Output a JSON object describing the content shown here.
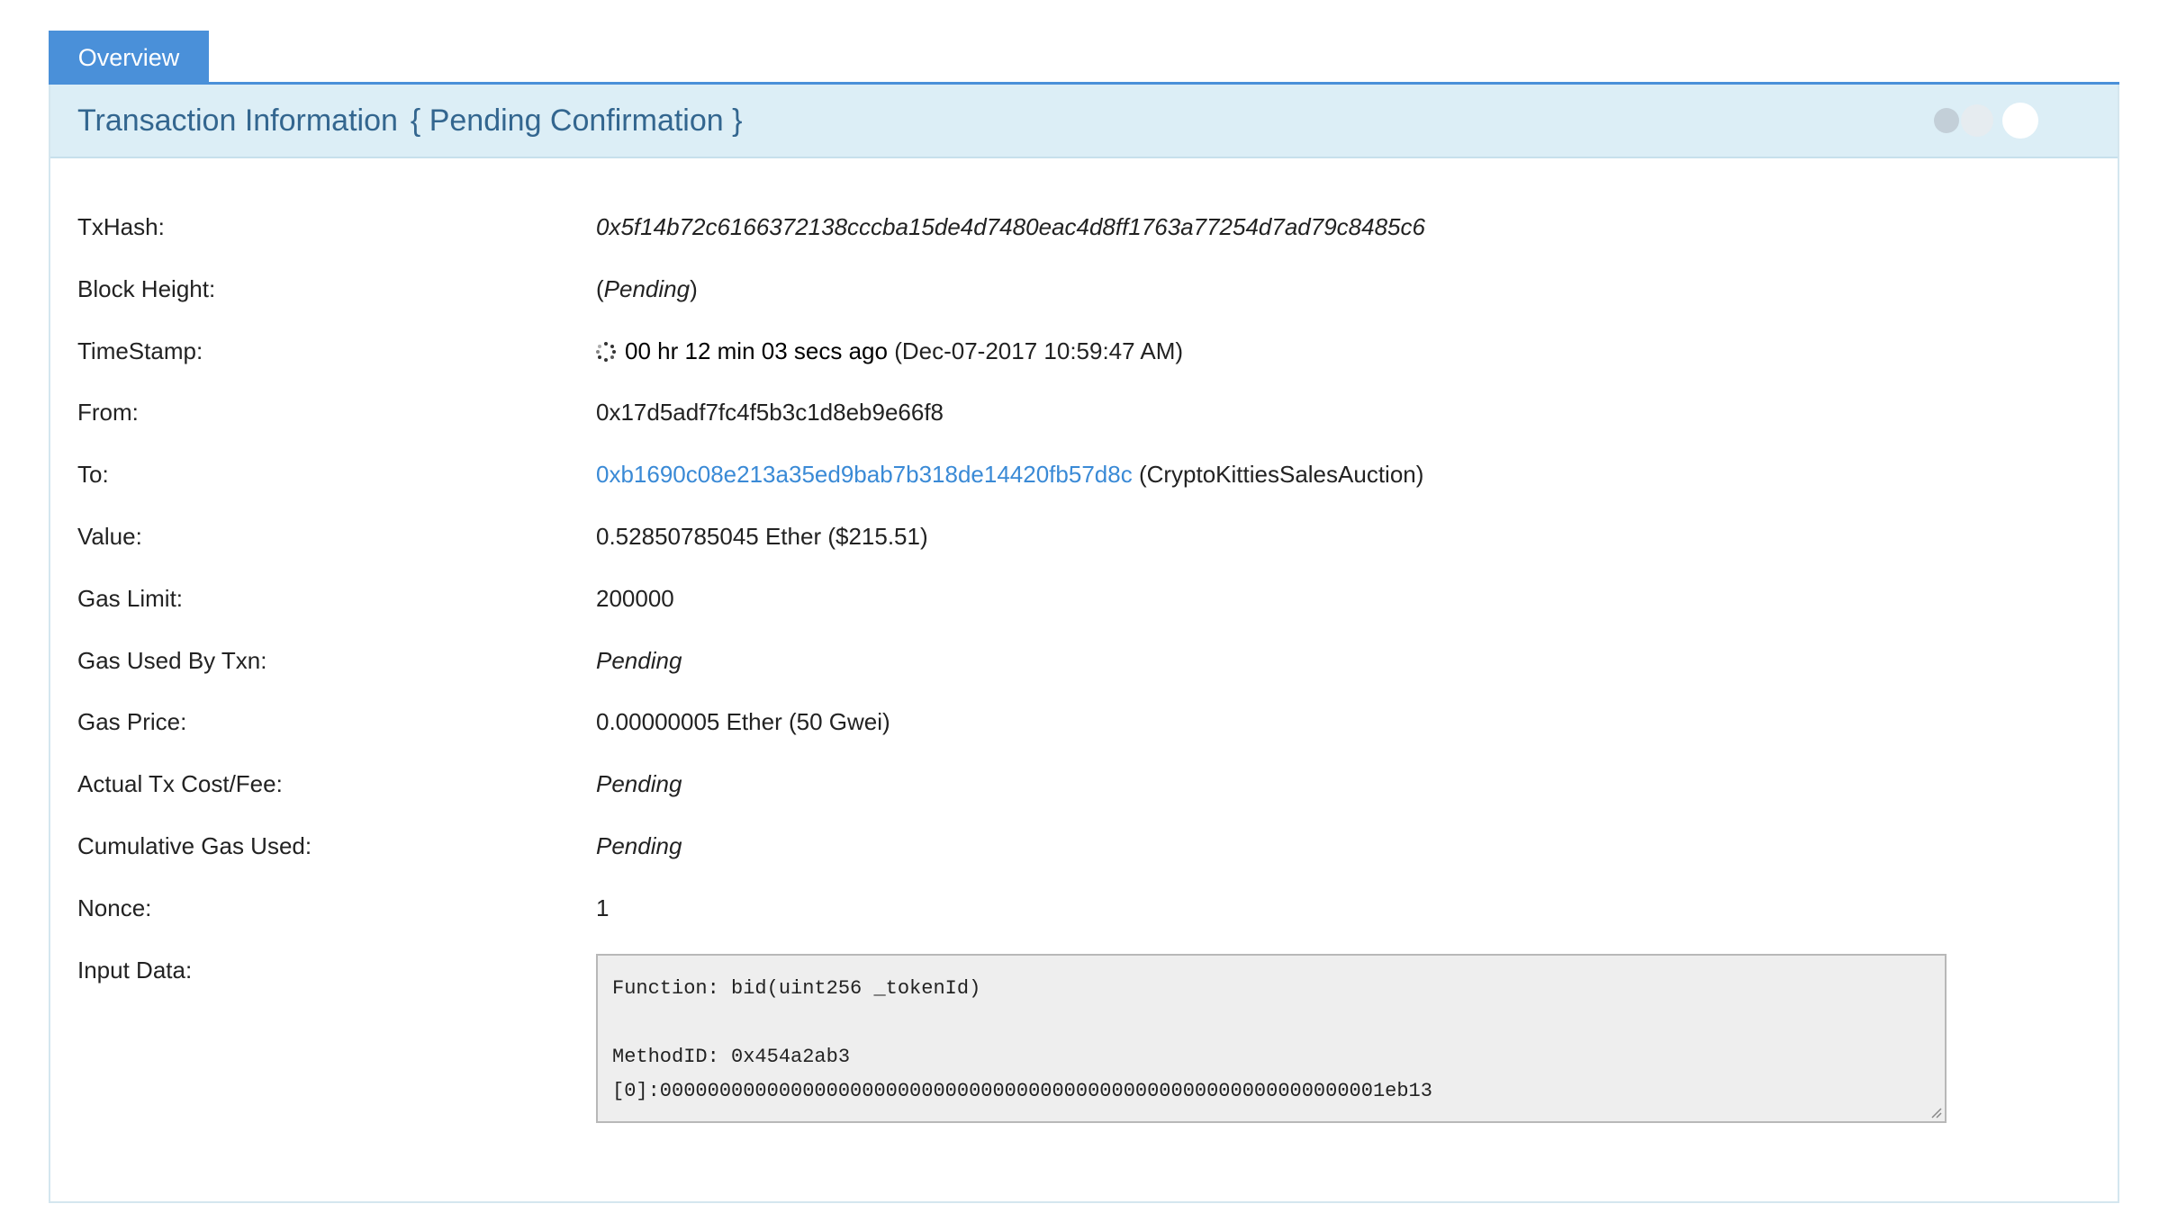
{
  "tabs": [
    {
      "label": "Overview"
    }
  ],
  "panel": {
    "title": "Transaction Information",
    "status": "{ Pending Confirmation }"
  },
  "fields": {
    "txhash": {
      "label": "TxHash:",
      "value": "0x5f14b72c6166372138cccba15de4d7480eac4d8ff1763a77254d7ad79c8485c6"
    },
    "block_height": {
      "label": "Block Height:",
      "open": "(",
      "value": "Pending",
      "close": ")"
    },
    "timestamp": {
      "label": "TimeStamp:",
      "ago": "00 hr 12 min 03 secs ago",
      "date": "(Dec-07-2017 10:59:47 AM)"
    },
    "from": {
      "label": "From:",
      "value": "0x17d5adf7fc4f5b3c1d8eb9e66f8"
    },
    "to": {
      "label": "To:",
      "value": "0xb1690c08e213a35ed9bab7b318de14420fb57d8c",
      "name": "(CryptoKittiesSalesAuction)"
    },
    "value": {
      "label": "Value:",
      "value": "0.52850785045 Ether ($215.51)"
    },
    "gas_limit": {
      "label": "Gas Limit:",
      "value": "200000"
    },
    "gas_used": {
      "label": "Gas Used By Txn:",
      "value": "Pending"
    },
    "gas_price": {
      "label": "Gas Price:",
      "value": "0.00000005 Ether (50 Gwei)"
    },
    "tx_fee": {
      "label": "Actual Tx Cost/Fee:",
      "value": "Pending"
    },
    "cumulative_gas": {
      "label": "Cumulative Gas Used:",
      "value": "Pending"
    },
    "nonce": {
      "label": "Nonce:",
      "value": "1"
    },
    "input_data": {
      "label": "Input Data:",
      "value": "Function: bid(uint256 _tokenId)\n\nMethodID: 0x454a2ab3\n[0]:0000000000000000000000000000000000000000000000000000000000001eb13"
    }
  }
}
